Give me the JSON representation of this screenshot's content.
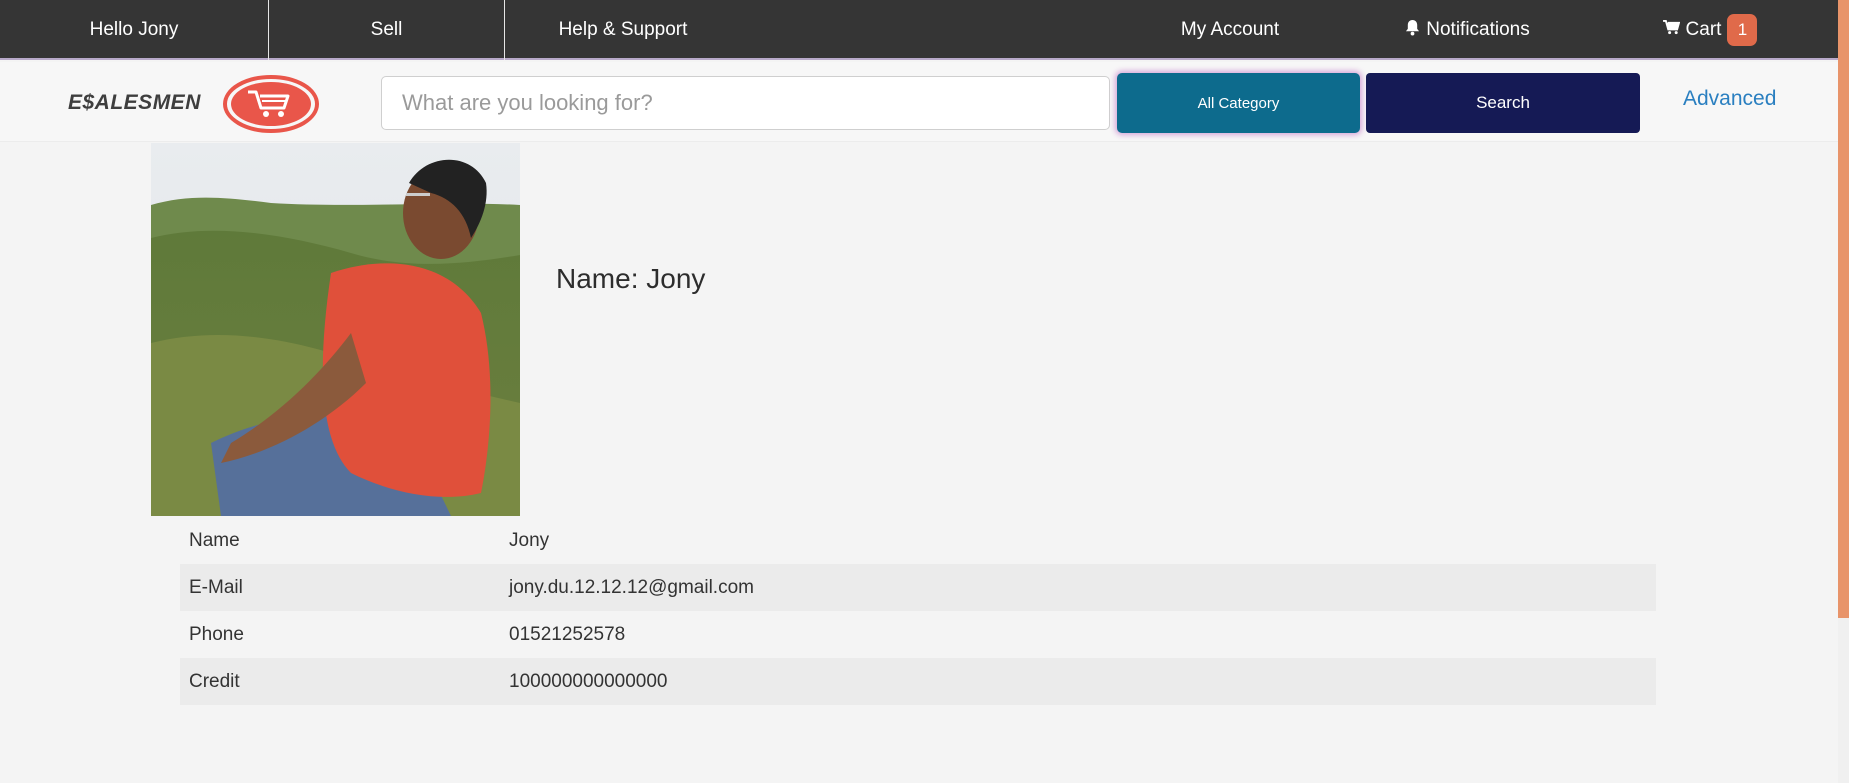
{
  "topnav": {
    "greeting": "Hello Jony",
    "sell": "Sell",
    "help": "Help & Support",
    "account": "My Account",
    "notifications": "Notifications",
    "cart": "Cart",
    "cart_count": "1"
  },
  "header": {
    "logo_text": "E$ALESMEN",
    "search_placeholder": "What are you looking for?",
    "category_label": "All Category",
    "search_label": "Search",
    "advanced_label": "Advanced"
  },
  "profile": {
    "name_heading": "Name: Jony"
  },
  "details": [
    {
      "label": "Name",
      "value": "Jony"
    },
    {
      "label": "E-Mail",
      "value": "jony.du.12.12.12@gmail.com"
    },
    {
      "label": "Phone",
      "value": "01521252578"
    },
    {
      "label": "Credit",
      "value": "100000000000000"
    }
  ],
  "colors": {
    "topbar": "#353535",
    "category_button": "#0d6b8d",
    "search_button": "#151a55",
    "accent_badge": "#e06a4a",
    "link": "#2a7fc0"
  }
}
